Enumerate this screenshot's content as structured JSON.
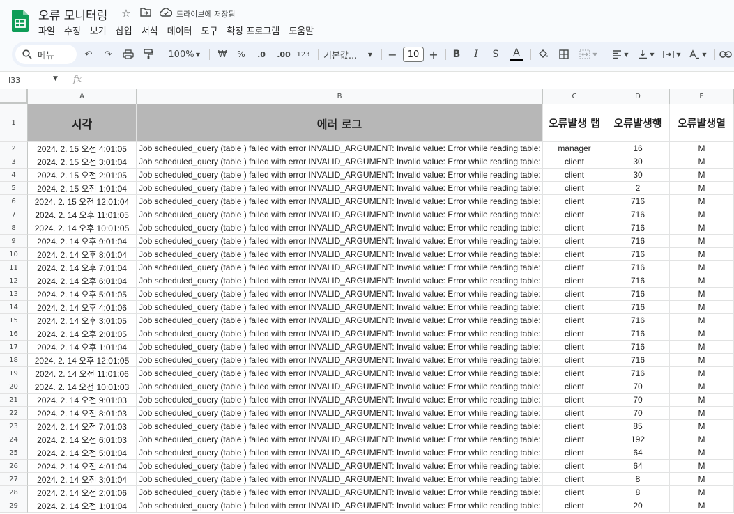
{
  "doc": {
    "title": "오류 모니터링",
    "save_status": "드라이브에 저장됨",
    "menu": [
      "파일",
      "수정",
      "보기",
      "삽입",
      "서식",
      "데이터",
      "도구",
      "확장 프로그램",
      "도움말"
    ]
  },
  "toolbar": {
    "search_label": "메뉴",
    "zoom": "100%",
    "currency": "₩",
    "percent": "%",
    "dec_decrease": ".0",
    "dec_increase": ".00",
    "number_format": "123",
    "font": "기본값...",
    "font_size": "10",
    "minus": "−",
    "plus": "+",
    "bold": "B",
    "italic": "I",
    "strike": "S",
    "text_color_letter": "A",
    "accent_color": "#0b57d0"
  },
  "formula_bar": {
    "cell_ref": "I33",
    "fx": "fx"
  },
  "sheet": {
    "columns": [
      "A",
      "B",
      "C",
      "D",
      "E"
    ],
    "headers": {
      "row_num": "1",
      "a": "시각",
      "b": "에러 로그",
      "c": "오류발생 탭",
      "d": "오류발생행",
      "e": "오류발생열"
    },
    "rows": [
      {
        "n": "2",
        "a": "2024. 2. 15 오전 4:01:05",
        "b": "Job scheduled_query (table ) failed with error INVALID_ARGUMENT: Invalid value: Error while reading table:",
        "c": "manager",
        "d": "16",
        "e": "M"
      },
      {
        "n": "3",
        "a": "2024. 2. 15 오전 3:01:04",
        "b": "Job scheduled_query (table ) failed with error INVALID_ARGUMENT: Invalid value: Error while reading table:",
        "c": "client",
        "d": "30",
        "e": "M"
      },
      {
        "n": "4",
        "a": "2024. 2. 15 오전 2:01:05",
        "b": "Job scheduled_query (table ) failed with error INVALID_ARGUMENT: Invalid value: Error while reading table:",
        "c": "client",
        "d": "30",
        "e": "M"
      },
      {
        "n": "5",
        "a": "2024. 2. 15 오전 1:01:04",
        "b": "Job scheduled_query (table ) failed with error INVALID_ARGUMENT: Invalid value: Error while reading table:",
        "c": "client",
        "d": "2",
        "e": "M"
      },
      {
        "n": "6",
        "a": "2024. 2. 15 오전 12:01:04",
        "b": "Job scheduled_query (table ) failed with error INVALID_ARGUMENT: Invalid value: Error while reading table:",
        "c": "client",
        "d": "716",
        "e": "M"
      },
      {
        "n": "7",
        "a": "2024. 2. 14 오후 11:01:05",
        "b": "Job scheduled_query (table ) failed with error INVALID_ARGUMENT: Invalid value: Error while reading table:",
        "c": "client",
        "d": "716",
        "e": "M"
      },
      {
        "n": "8",
        "a": "2024. 2. 14 오후 10:01:05",
        "b": "Job scheduled_query (table ) failed with error INVALID_ARGUMENT: Invalid value: Error while reading table:",
        "c": "client",
        "d": "716",
        "e": "M"
      },
      {
        "n": "9",
        "a": "2024. 2. 14 오후 9:01:04",
        "b": "Job scheduled_query (table ) failed with error INVALID_ARGUMENT: Invalid value: Error while reading table:",
        "c": "client",
        "d": "716",
        "e": "M"
      },
      {
        "n": "10",
        "a": "2024. 2. 14 오후 8:01:04",
        "b": "Job scheduled_query (table ) failed with error INVALID_ARGUMENT: Invalid value: Error while reading table:",
        "c": "client",
        "d": "716",
        "e": "M"
      },
      {
        "n": "11",
        "a": "2024. 2. 14 오후 7:01:04",
        "b": "Job scheduled_query (table ) failed with error INVALID_ARGUMENT: Invalid value: Error while reading table:",
        "c": "client",
        "d": "716",
        "e": "M"
      },
      {
        "n": "12",
        "a": "2024. 2. 14 오후 6:01:04",
        "b": "Job scheduled_query (table ) failed with error INVALID_ARGUMENT: Invalid value: Error while reading table:",
        "c": "client",
        "d": "716",
        "e": "M"
      },
      {
        "n": "13",
        "a": "2024. 2. 14 오후 5:01:05",
        "b": "Job scheduled_query (table ) failed with error INVALID_ARGUMENT: Invalid value: Error while reading table:",
        "c": "client",
        "d": "716",
        "e": "M"
      },
      {
        "n": "14",
        "a": "2024. 2. 14 오후 4:01:06",
        "b": "Job scheduled_query (table ) failed with error INVALID_ARGUMENT: Invalid value: Error while reading table:",
        "c": "client",
        "d": "716",
        "e": "M"
      },
      {
        "n": "15",
        "a": "2024. 2. 14 오후 3:01:05",
        "b": "Job scheduled_query (table ) failed with error INVALID_ARGUMENT: Invalid value: Error while reading table:",
        "c": "client",
        "d": "716",
        "e": "M"
      },
      {
        "n": "16",
        "a": "2024. 2. 14 오후 2:01:05",
        "b": "Job scheduled_query (table ) failed with error INVALID_ARGUMENT: Invalid value: Error while reading table:",
        "c": "client",
        "d": "716",
        "e": "M"
      },
      {
        "n": "17",
        "a": "2024. 2. 14 오후 1:01:04",
        "b": "Job scheduled_query (table ) failed with error INVALID_ARGUMENT: Invalid value: Error while reading table:",
        "c": "client",
        "d": "716",
        "e": "M"
      },
      {
        "n": "18",
        "a": "2024. 2. 14 오후 12:01:05",
        "b": "Job scheduled_query (table ) failed with error INVALID_ARGUMENT: Invalid value: Error while reading table:",
        "c": "client",
        "d": "716",
        "e": "M"
      },
      {
        "n": "19",
        "a": "2024. 2. 14 오전 11:01:06",
        "b": "Job scheduled_query (table ) failed with error INVALID_ARGUMENT: Invalid value: Error while reading table:",
        "c": "client",
        "d": "716",
        "e": "M"
      },
      {
        "n": "20",
        "a": "2024. 2. 14 오전 10:01:03",
        "b": "Job scheduled_query (table ) failed with error INVALID_ARGUMENT: Invalid value: Error while reading table:",
        "c": "client",
        "d": "70",
        "e": "M"
      },
      {
        "n": "21",
        "a": "2024. 2. 14 오전 9:01:03",
        "b": "Job scheduled_query (table ) failed with error INVALID_ARGUMENT: Invalid value: Error while reading table:",
        "c": "client",
        "d": "70",
        "e": "M"
      },
      {
        "n": "22",
        "a": "2024. 2. 14 오전 8:01:03",
        "b": "Job scheduled_query (table ) failed with error INVALID_ARGUMENT: Invalid value: Error while reading table:",
        "c": "client",
        "d": "70",
        "e": "M"
      },
      {
        "n": "23",
        "a": "2024. 2. 14 오전 7:01:03",
        "b": "Job scheduled_query (table ) failed with error INVALID_ARGUMENT: Invalid value: Error while reading table:",
        "c": "client",
        "d": "85",
        "e": "M"
      },
      {
        "n": "24",
        "a": "2024. 2. 14 오전 6:01:03",
        "b": "Job scheduled_query (table ) failed with error INVALID_ARGUMENT: Invalid value: Error while reading table:",
        "c": "client",
        "d": "192",
        "e": "M"
      },
      {
        "n": "25",
        "a": "2024. 2. 14 오전 5:01:04",
        "b": "Job scheduled_query (table ) failed with error INVALID_ARGUMENT: Invalid value: Error while reading table:",
        "c": "client",
        "d": "64",
        "e": "M"
      },
      {
        "n": "26",
        "a": "2024. 2. 14 오전 4:01:04",
        "b": "Job scheduled_query (table ) failed with error INVALID_ARGUMENT: Invalid value: Error while reading table:",
        "c": "client",
        "d": "64",
        "e": "M"
      },
      {
        "n": "27",
        "a": "2024. 2. 14 오전 3:01:04",
        "b": "Job scheduled_query (table ) failed with error INVALID_ARGUMENT: Invalid value: Error while reading table:",
        "c": "client",
        "d": "8",
        "e": "M"
      },
      {
        "n": "28",
        "a": "2024. 2. 14 오전 2:01:06",
        "b": "Job scheduled_query (table ) failed with error INVALID_ARGUMENT: Invalid value: Error while reading table:",
        "c": "client",
        "d": "8",
        "e": "M"
      },
      {
        "n": "29",
        "a": "2024. 2. 14 오전 1:01:04",
        "b": "Job scheduled_query (table ) failed with error INVALID_ARGUMENT: Invalid value: Error while reading table:",
        "c": "client",
        "d": "20",
        "e": "M"
      }
    ]
  }
}
